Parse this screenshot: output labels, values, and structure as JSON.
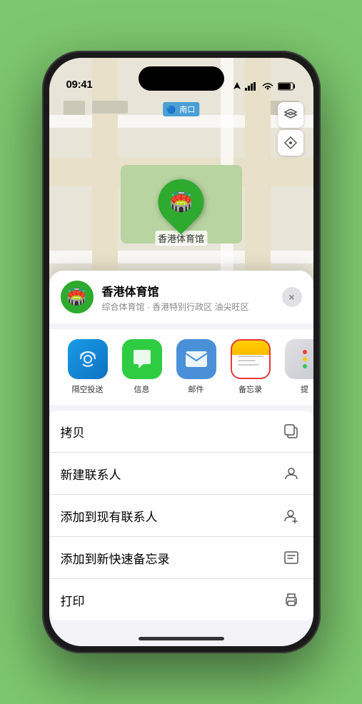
{
  "status_bar": {
    "time": "09:41",
    "signal_icon": "signal-icon",
    "wifi_icon": "wifi-icon",
    "battery_icon": "battery-icon",
    "location_icon": "location-arrow-icon"
  },
  "map": {
    "label": "南口",
    "controls": {
      "map_type_icon": "map-layers-icon",
      "location_icon": "location-arrow-icon"
    },
    "pin": {
      "label": "香港体育馆"
    }
  },
  "venue_card": {
    "name": "香港体育馆",
    "subtitle": "综合体育馆 · 香港特别行政区 油尖旺区",
    "close_label": "×"
  },
  "share_row": {
    "items": [
      {
        "id": "airdrop",
        "label": "隔空投送",
        "icon": "airdrop-icon",
        "selected": false
      },
      {
        "id": "messages",
        "label": "信息",
        "icon": "messages-icon",
        "selected": false
      },
      {
        "id": "mail",
        "label": "邮件",
        "icon": "mail-icon",
        "selected": false
      },
      {
        "id": "notes",
        "label": "备忘录",
        "icon": "notes-icon",
        "selected": true
      },
      {
        "id": "more",
        "label": "提",
        "icon": "more-icon",
        "selected": false
      }
    ]
  },
  "action_list": {
    "items": [
      {
        "id": "copy",
        "label": "拷贝",
        "icon": "copy-icon"
      },
      {
        "id": "new-contact",
        "label": "新建联系人",
        "icon": "new-contact-icon"
      },
      {
        "id": "add-existing",
        "label": "添加到现有联系人",
        "icon": "add-contact-icon"
      },
      {
        "id": "add-note",
        "label": "添加到新快速备忘录",
        "icon": "quick-note-icon"
      },
      {
        "id": "print",
        "label": "打印",
        "icon": "print-icon"
      }
    ]
  }
}
